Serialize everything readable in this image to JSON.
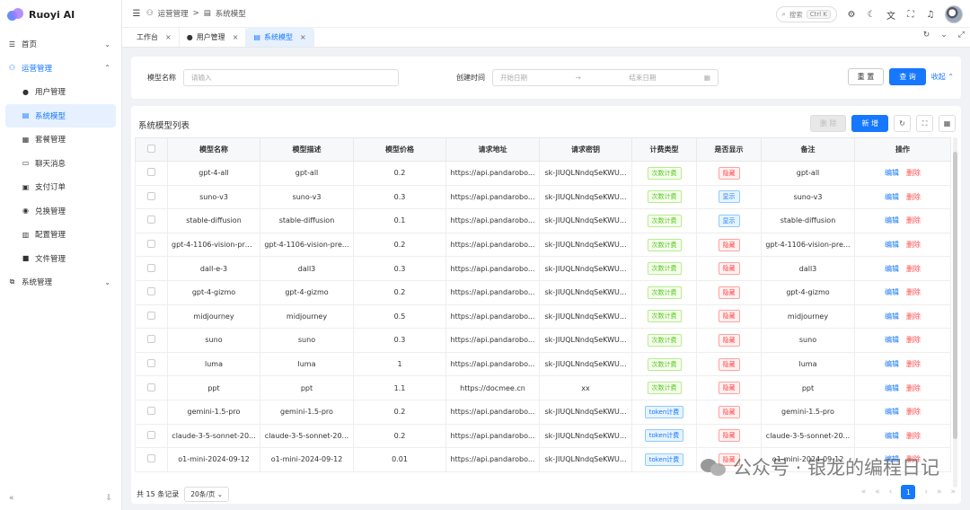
{
  "app": {
    "title": "Ruoyi AI"
  },
  "sidebar": {
    "items": [
      {
        "label": "首页",
        "icon": "home-icon",
        "chevron": "⌄"
      },
      {
        "label": "运营管理",
        "icon": "operations-icon",
        "chevron": "⌃"
      },
      {
        "label": "用户管理",
        "icon": "user-icon"
      },
      {
        "label": "系统模型",
        "icon": "model-icon"
      },
      {
        "label": "套餐管理",
        "icon": "package-icon"
      },
      {
        "label": "聊天消息",
        "icon": "chat-icon"
      },
      {
        "label": "支付订单",
        "icon": "order-icon"
      },
      {
        "label": "兑换管理",
        "icon": "exchange-icon"
      },
      {
        "label": "配置管理",
        "icon": "config-icon"
      },
      {
        "label": "文件管理",
        "icon": "folder-icon"
      },
      {
        "label": "系统管理",
        "icon": "system-icon",
        "chevron": "⌄"
      }
    ],
    "footer": {
      "collapse": "«",
      "pin": "⇩"
    }
  },
  "topbar": {
    "breadcrumb": [
      "运营管理",
      "系统模型"
    ],
    "separator": ">",
    "search": {
      "label": "搜索",
      "shortcut": "Ctrl K"
    }
  },
  "tabs": [
    {
      "label": "工作台",
      "close": "×"
    },
    {
      "label": "用户管理",
      "close": "×"
    },
    {
      "label": "系统模型",
      "close": "×"
    }
  ],
  "filter": {
    "model_name_label": "模型名称",
    "model_name_placeholder": "请输入",
    "created_label": "创建时间",
    "start_placeholder": "开始日期",
    "arrow": "→",
    "end_placeholder": "结束日期",
    "reset_label": "重 置",
    "query_label": "查 询",
    "collapse_label": "收起"
  },
  "panel": {
    "title": "系统模型列表",
    "delete_label": "删 除",
    "add_label": "新 增"
  },
  "table": {
    "columns": [
      "",
      "模型名称",
      "模型描述",
      "模型价格",
      "请求地址",
      "请求密钥",
      "计费类型",
      "是否显示",
      "备注",
      "操作"
    ],
    "edit_label": "编辑",
    "delete_label": "删除",
    "rows": [
      {
        "name": "gpt-4-all",
        "desc": "gpt-all",
        "price": "0.2",
        "url": "https://api.pandarobo...",
        "key": "sk-JIUQLNndqSeKWU...",
        "billing": "次数计费",
        "billing_type": "green",
        "show": "隐藏",
        "show_type": "red",
        "remark": "gpt-all"
      },
      {
        "name": "suno-v3",
        "desc": "suno-v3",
        "price": "0.3",
        "url": "https://api.pandarobo...",
        "key": "sk-JIUQLNndqSeKWU...",
        "billing": "次数计费",
        "billing_type": "green",
        "show": "显示",
        "show_type": "blue",
        "remark": "suno-v3"
      },
      {
        "name": "stable-diffusion",
        "desc": "stable-diffusion",
        "price": "0.1",
        "url": "https://api.pandarobo...",
        "key": "sk-JIUQLNndqSeKWU...",
        "billing": "次数计费",
        "billing_type": "green",
        "show": "显示",
        "show_type": "blue",
        "remark": "stable-diffusion"
      },
      {
        "name": "gpt-4-1106-vision-pre...",
        "desc": "gpt-4-1106-vision-pre...",
        "price": "0.2",
        "url": "https://api.pandarobo...",
        "key": "sk-JIUQLNndqSeKWU...",
        "billing": "次数计费",
        "billing_type": "green",
        "show": "隐藏",
        "show_type": "red",
        "remark": "gpt-4-1106-vision-pre..."
      },
      {
        "name": "dall-e-3",
        "desc": "dall3",
        "price": "0.3",
        "url": "https://api.pandarobo...",
        "key": "sk-JIUQLNndqSeKWU...",
        "billing": "次数计费",
        "billing_type": "green",
        "show": "隐藏",
        "show_type": "red",
        "remark": "dall3"
      },
      {
        "name": "gpt-4-gizmo",
        "desc": "gpt-4-gizmo",
        "price": "0.2",
        "url": "https://api.pandarobo...",
        "key": "sk-JIUQLNndqSeKWU...",
        "billing": "次数计费",
        "billing_type": "green",
        "show": "隐藏",
        "show_type": "red",
        "remark": "gpt-4-gizmo"
      },
      {
        "name": "midjourney",
        "desc": "midjourney",
        "price": "0.5",
        "url": "https://api.pandarobo...",
        "key": "sk-JIUQLNndqSeKWU...",
        "billing": "次数计费",
        "billing_type": "green",
        "show": "隐藏",
        "show_type": "red",
        "remark": "midjourney"
      },
      {
        "name": "suno",
        "desc": "suno",
        "price": "0.3",
        "url": "https://api.pandarobo...",
        "key": "sk-JIUQLNndqSeKWU...",
        "billing": "次数计费",
        "billing_type": "green",
        "show": "隐藏",
        "show_type": "red",
        "remark": "suno"
      },
      {
        "name": "luma",
        "desc": "luma",
        "price": "1",
        "url": "https://api.pandarobo...",
        "key": "sk-JIUQLNndqSeKWU...",
        "billing": "次数计费",
        "billing_type": "green",
        "show": "隐藏",
        "show_type": "red",
        "remark": "luma"
      },
      {
        "name": "ppt",
        "desc": "ppt",
        "price": "1.1",
        "url": "https://docmee.cn",
        "key": "xx",
        "billing": "次数计费",
        "billing_type": "green",
        "show": "隐藏",
        "show_type": "red",
        "remark": "ppt"
      },
      {
        "name": "gemini-1.5-pro",
        "desc": "gemini-1.5-pro",
        "price": "0.2",
        "url": "https://api.pandarobo...",
        "key": "sk-JIUQLNndqSeKWU...",
        "billing": "token计费",
        "billing_type": "blue",
        "show": "隐藏",
        "show_type": "red",
        "remark": "gemini-1.5-pro"
      },
      {
        "name": "claude-3-5-sonnet-20...",
        "desc": "claude-3-5-sonnet-20...",
        "price": "0.2",
        "url": "https://api.pandarobo...",
        "key": "sk-JIUQLNndqSeKWU...",
        "billing": "token计费",
        "billing_type": "blue",
        "show": "隐藏",
        "show_type": "red",
        "remark": "claude-3-5-sonnet-20..."
      },
      {
        "name": "o1-mini-2024-09-12",
        "desc": "o1-mini-2024-09-12",
        "price": "0.01",
        "url": "https://api.pandarobo...",
        "key": "sk-JIUQLNndqSeKWU...",
        "billing": "token计费",
        "billing_type": "blue",
        "show": "隐藏",
        "show_type": "red",
        "remark": "o1-mini-2024-09-12"
      }
    ]
  },
  "pagination": {
    "total_label": "共 15 条记录",
    "page_size": "20条/页",
    "current_page": "1",
    "first": "«",
    "prev_group": "«",
    "prev": "‹",
    "next": "›",
    "next_group": "»",
    "last": "»"
  },
  "watermark": {
    "text": "公众号 · 银龙的编程日记"
  },
  "colors": {
    "primary": "#1677ff",
    "danger": "#ff4d4f",
    "success": "#52c41a"
  }
}
